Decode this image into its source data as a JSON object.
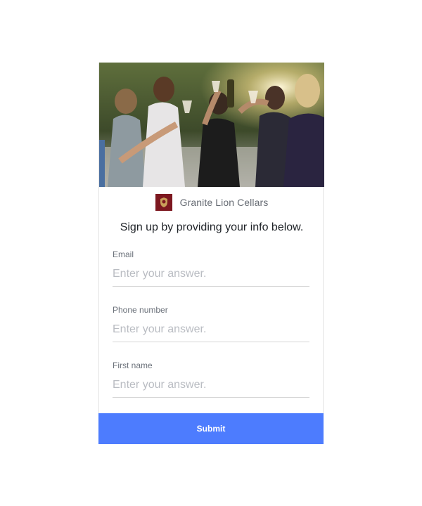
{
  "brand": {
    "name": "Granite Lion Cellars",
    "logo_icon": "lion-crest-icon",
    "logo_color": "#7d1820"
  },
  "form": {
    "headline": "Sign up by providing your info below.",
    "fields": [
      {
        "label": "Email",
        "placeholder": "Enter your answer.",
        "value": ""
      },
      {
        "label": "Phone number",
        "placeholder": "Enter your answer.",
        "value": ""
      },
      {
        "label": "First name",
        "placeholder": "Enter your answer.",
        "value": ""
      }
    ],
    "submit_label": "Submit"
  },
  "colors": {
    "accent": "#4d7cfe",
    "label_text": "#6b717a",
    "placeholder_text": "#b9bcc2"
  },
  "hero": {
    "image_icon": "wine-toast-photo"
  }
}
